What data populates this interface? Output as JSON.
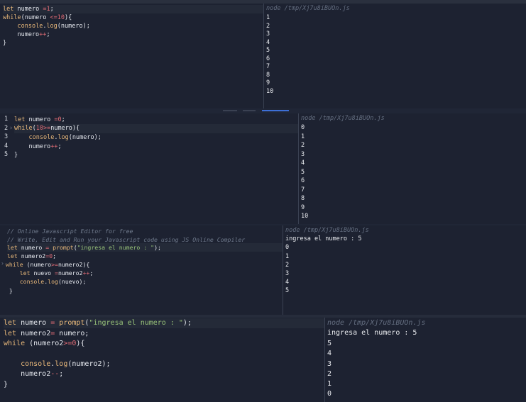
{
  "panel1": {
    "code": [
      "let numero =1;",
      "while(numero <=10){",
      "    console.log(numero);",
      "    numero++;",
      "}"
    ],
    "output_header": "node /tmp/Xj7u8iBUOn.js",
    "output": [
      "1",
      "2",
      "3",
      "4",
      "5",
      "6",
      "7",
      "8",
      "9",
      "10"
    ]
  },
  "panel2": {
    "line_numbers": [
      "1",
      "2",
      "3",
      "4",
      "5"
    ],
    "code": [
      "let numero =0;",
      "while(10>=numero){",
      "    console.log(numero);",
      "    numero++;",
      "}"
    ],
    "output_header": "node /tmp/Xj7u8iBUOn.js",
    "output": [
      "0",
      "1",
      "2",
      "3",
      "4",
      "5",
      "6",
      "7",
      "8",
      "9",
      "10"
    ]
  },
  "panel3": {
    "code": [
      "// Online Javascript Editor for free",
      "// Write, Edit and Run your Javascript code using JS Online Compiler",
      "let numero = prompt(\"ingresa el numero : \");",
      "let numero2=0;",
      "while (numero>=numero2){",
      "    let nuevo =numero2++;",
      "    console.log(nuevo);",
      "}"
    ],
    "output_header": "node /tmp/Xj7u8iBUOn.js",
    "output": [
      "ingresa el numero : 5",
      "0",
      "1",
      "2",
      "3",
      "4",
      "5"
    ]
  },
  "panel4": {
    "code": [
      "let numero = prompt(\"ingresa el numero : \");",
      "let numero2= numero;",
      "while (numero2>=0){",
      "",
      "    console.log(numero2);",
      "    numero2--;",
      "}"
    ],
    "output_header": "node /tmp/Xj7u8iBUOn.js",
    "output": [
      "ingresa el numero : 5",
      "5",
      "4",
      "3",
      "2",
      "1",
      "0"
    ]
  },
  "colors": {
    "keyword": "#e8b87a",
    "number": "#e06c75",
    "string": "#98c379",
    "comment": "#6f7a8c",
    "background": "#1d2231",
    "tab_accent": "#3d6fd6"
  }
}
